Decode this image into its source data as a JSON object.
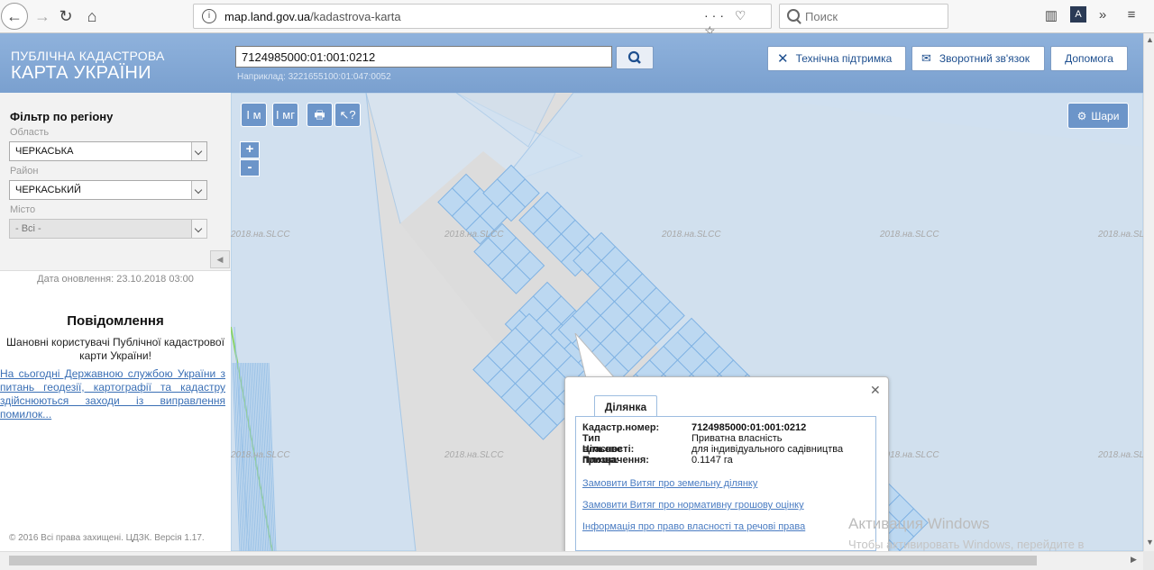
{
  "browser": {
    "url_domain": "map.land.gov.ua",
    "url_path": "/kadastrova-karta",
    "url_actions": "··· ♡ ☆",
    "search_placeholder": "Поиск",
    "toolbar_icons": [
      "library-icon",
      "extension-icon",
      "overflow-icon",
      "menu-icon"
    ]
  },
  "header": {
    "logo_line1": "ПУБЛІЧНА КАДАСТРОВА",
    "logo_line2": "КАРТА УКРАЇНИ",
    "search_value": "7124985000:01:001:0212",
    "search_example": "Наприклад: 3221655100:01:047:0052",
    "buttons": {
      "support": "Технічна підтримка",
      "feedback": "Зворотний зв'язок",
      "help": "Допомога"
    }
  },
  "sidebar": {
    "filter_title": "Фільтр по регіону",
    "oblast_label": "Область",
    "oblast_value": "ЧЕРКАСЬКА",
    "rayon_label": "Район",
    "rayon_value": "ЧЕРКАСЬКИЙ",
    "misto_label": "Місто",
    "misto_value": "- Всі -",
    "updated": "Дата оновлення: 23.10.2018 03:00",
    "message_title": "Повідомлення",
    "message_body": "Шановні користувачі Публічної кадастрової карти України!",
    "message_link": "На сьогодні Державною службою України з питань геодезії, картографії та кадастру здійснюються заходи із виправлення помилок...",
    "copyright": "© 2016 Всі права захищені. ЦДЗК. Версія 1.17."
  },
  "map": {
    "tools": [
      "І м",
      "І мг",
      "🖶",
      "↖?"
    ],
    "zoom_in": "+",
    "zoom_out": "-",
    "layers_label": "Шари",
    "watermark": "2018.на.SLCC"
  },
  "popup": {
    "tab": "Ділянка",
    "rows": [
      {
        "key": "Кадастр.номер:",
        "value": "7124985000:01:001:0212"
      },
      {
        "key": "Тип власності:",
        "value": "Приватна власність"
      },
      {
        "key": "Цільове призначення:",
        "value": "для індивідуального садівництва"
      },
      {
        "key": "Площа:",
        "value": "0.1147 га"
      }
    ],
    "links": [
      "Замовити Витяг про земельну ділянку",
      "Замовити Витяг про нормативну грошову оцінку",
      "Інформація про право власності та речові права"
    ]
  },
  "windows": {
    "activation_title": "Активация Windows",
    "activation_body": "Чтобы активировать Windows, перейдите в раздел \"Параметры\"."
  }
}
